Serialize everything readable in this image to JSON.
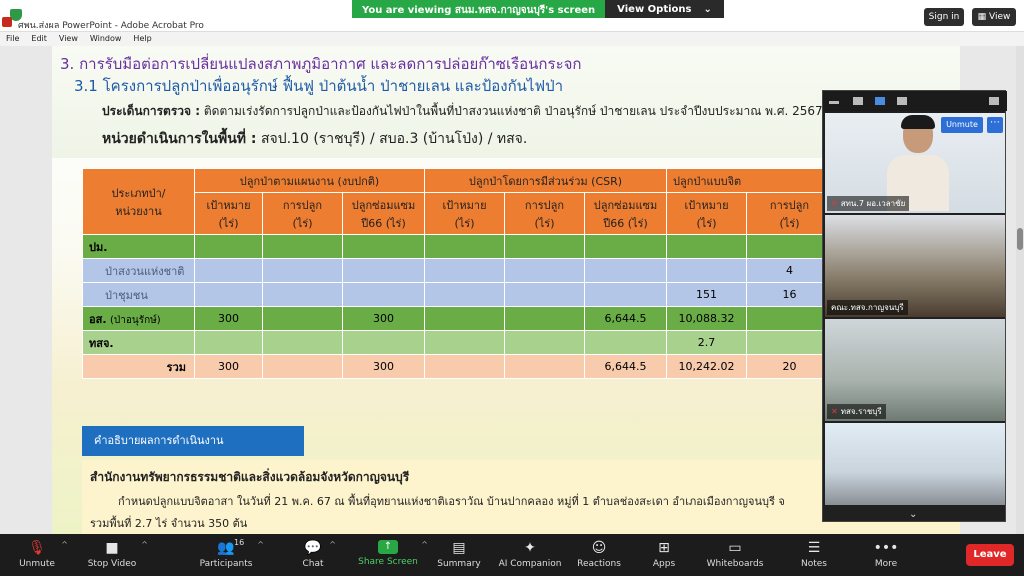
{
  "window": {
    "title": "ศพน.ส่งผล PowerPoint - Adobe Acrobat Pro",
    "viewing_banner": "You are viewing สนม.ทสจ.กาญจนบุรี's screen",
    "view_options": "View Options",
    "sign_in": "Sign in",
    "view": "View"
  },
  "menu": [
    "File",
    "Edit",
    "View",
    "Window",
    "Help"
  ],
  "slide": {
    "heading1": "3. การรับมือต่อการเปลี่ยนแปลงสภาพภูมิอากาศ และลดการปล่อยก๊าซเรือนกระจก",
    "heading2": "3.1 โครงการปลูกป่าเพื่ออนุรักษ์ ฟื้นฟู ป่าต้นน้ำ ป่าชายเลน และป้องกันไฟป่า",
    "issue_label": "ประเด็นการตรวจ :",
    "issue_text": "ติดตามเร่งรัดการปลูกป่าและป้องกันไฟป่าในพื้นที่ป่าสงวนแห่งชาติ ป่าอนุรักษ์ ป่าชายเลน ประจำปีงบประมาณ พ.ศ. 2567 แ",
    "unit_label": "หน่วยดำเนินการในพื้นที่ :",
    "unit_text": "สจป.10 (ราชบุรี) / สบอ.3 (บ้านโป่ง) / ทสจ.",
    "table": {
      "corner_header": [
        "ประเภทป่า/",
        "หน่วยงาน"
      ],
      "group_headers": [
        "ปลูกป่าตามแผนงาน (งบปกติ)",
        "ปลูกป่าโดยการมีส่วนร่วม (CSR)",
        "ปลูกป่าแบบจิต"
      ],
      "sub_headers": [
        [
          "เป้าหมาย",
          "(ไร่)"
        ],
        [
          "การปลูก",
          "(ไร่)"
        ],
        [
          "ปลูกซ่อมแซม",
          "ปี66 (ไร่)"
        ],
        [
          "เป้าหมาย",
          "(ไร่)"
        ],
        [
          "การปลูก",
          "(ไร่)"
        ],
        [
          "ปลูกซ่อมแซม",
          "ปี66 (ไร่)"
        ],
        [
          "เป้าหมาย",
          "(ไร่)"
        ],
        [
          "การปลูก",
          "(ไร่)"
        ]
      ],
      "rows": [
        {
          "label": "ปม.",
          "cells": [
            "",
            "",
            "",
            "",
            "",
            "",
            "",
            ""
          ]
        },
        {
          "label": "ป่าสงวนแห่งชาติ",
          "cells": [
            "",
            "",
            "",
            "",
            "",
            "",
            "",
            "4"
          ]
        },
        {
          "label": "ป่าชุมชน",
          "cells": [
            "",
            "",
            "",
            "",
            "",
            "",
            "151",
            "16"
          ]
        },
        {
          "label": "อส.",
          "label_note": "(ป่าอนุรักษ์)",
          "cells": [
            "300",
            "",
            "300",
            "",
            "",
            "6,644.5",
            "10,088.32",
            ""
          ]
        },
        {
          "label": "ทสจ.",
          "cells": [
            "",
            "",
            "",
            "",
            "",
            "",
            "2.7",
            ""
          ]
        },
        {
          "label": "รวม",
          "cells": [
            "300",
            "",
            "300",
            "",
            "",
            "6,644.5",
            "10,242.02",
            "20"
          ]
        }
      ]
    },
    "desc_button": "คำอธิบายผลการดำเนินงาน",
    "desc_org": "สำนักงานทรัพยากรธรรมชาติและสิ่งแวดล้อมจังหวัดกาญจนบุรี",
    "desc_p1": "กำหนดปลูกแบบจิตอาสา ในวันที่ 21 พ.ค. 67 ณ พื้นที่อุทยานแห่งชาติเอราวัณ บ้านปากคลอง หมู่ที่ 1 ตำบลช่องสะเดา อำเภอเมืองกาญจนบุรี จ",
    "desc_p2": "รวมพื้นที่ 2.7 ไร่ จำนวน 350 ต้น"
  },
  "gallery": {
    "tiles": [
      {
        "name": "สทน.7 ผอ.เวลาชัย",
        "muted": true
      },
      {
        "name": "คณะ.ทสจ.กาญจนบุรี",
        "muted": false
      },
      {
        "name": "ทสจ.ราชบุรี",
        "muted": true
      },
      {
        "name": "",
        "muted": false
      }
    ],
    "unmute": "Unmute",
    "more": "⋯"
  },
  "toolbar": {
    "items": [
      {
        "label": "Unmute",
        "icon": "mic-off-icon"
      },
      {
        "label": "Stop Video",
        "icon": "video-icon"
      },
      {
        "label": "Participants",
        "icon": "participants-icon",
        "count": "16"
      },
      {
        "label": "Chat",
        "icon": "chat-icon"
      },
      {
        "label": "Share Screen",
        "icon": "share-icon"
      },
      {
        "label": "Summary",
        "icon": "summary-icon"
      },
      {
        "label": "AI Companion",
        "icon": "ai-icon"
      },
      {
        "label": "Reactions",
        "icon": "reactions-icon"
      },
      {
        "label": "Apps",
        "icon": "apps-icon"
      },
      {
        "label": "Whiteboards",
        "icon": "whiteboard-icon"
      },
      {
        "label": "Notes",
        "icon": "notes-icon"
      },
      {
        "label": "More",
        "icon": "more-icon"
      }
    ],
    "leave": "Leave"
  },
  "colors": {
    "header_orange": "#ed7d31",
    "green": "#6aad46",
    "blue_light": "#b4c6e7",
    "peach": "#f8cbad",
    "share_green": "#2aa745",
    "leave_red": "#e02828"
  }
}
